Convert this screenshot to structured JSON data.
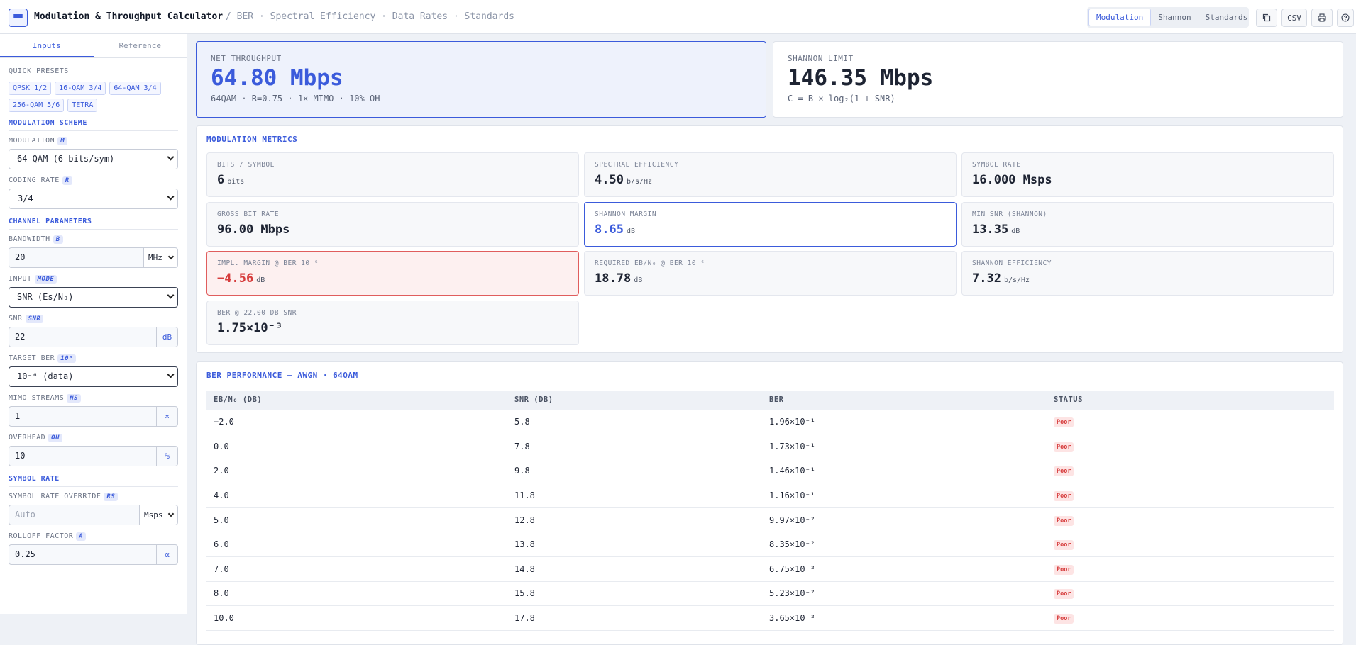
{
  "header": {
    "title": "Modulation & Throughput Calculator",
    "breadcrumb": "/ BER · Spectral Efficiency · Data Rates · Standards",
    "tabs": [
      "Modulation",
      "Shannon",
      "Standards"
    ],
    "active_tab": "Modulation",
    "tools": {
      "copy_icon": "copy-icon",
      "csv_label": "CSV",
      "print_icon": "print-icon",
      "help_icon": "help-icon"
    }
  },
  "sidebar": {
    "tabs": [
      "Inputs",
      "Reference"
    ],
    "quick_presets_label": "QUICK PRESETS",
    "presets": [
      "QPSK 1/2",
      "16-QAM 3/4",
      "64-QAM 3/4",
      "256-QAM 5/6",
      "TETRA"
    ],
    "modulation_scheme_label": "MODULATION SCHEME",
    "modulation": {
      "label": "MODULATION",
      "tag": "M",
      "value": "64-QAM (6 bits/sym)"
    },
    "coding_rate": {
      "label": "CODING RATE",
      "tag": "R",
      "value": "3/4"
    },
    "channel_params_label": "CHANNEL PARAMETERS",
    "bandwidth": {
      "label": "BANDWIDTH",
      "tag": "B",
      "value": "20",
      "unit": "MHz"
    },
    "input_mode": {
      "label": "INPUT",
      "tag": "MODE",
      "value": "SNR (Es/N₀)"
    },
    "snr": {
      "label": "SNR",
      "tag": "SNR",
      "value": "22",
      "unit": "dB"
    },
    "target_ber": {
      "label": "TARGET BER",
      "tag": "10ˣ",
      "value": "10⁻⁶ (data)"
    },
    "mimo": {
      "label": "MIMO STREAMS",
      "tag": "NS",
      "value": "1",
      "unit": "×"
    },
    "overhead": {
      "label": "OVERHEAD",
      "tag": "OH",
      "value": "10",
      "unit": "%"
    },
    "symbol_rate_label": "SYMBOL RATE",
    "symbol_rate_override": {
      "label": "SYMBOL RATE OVERRIDE",
      "tag": "RS",
      "placeholder": "Auto",
      "unit": "Msps"
    },
    "rolloff": {
      "label": "ROLLOFF FACTOR",
      "tag": "A",
      "value": "0.25",
      "unit": "α"
    }
  },
  "hero": {
    "net": {
      "label": "NET THROUGHPUT",
      "value": "64.80 Mbps",
      "sub": "64QAM · R=0.75 · 1× MIMO · 10% OH"
    },
    "shannon": {
      "label": "SHANNON LIMIT",
      "value": "146.35 Mbps",
      "sub": "C = B × log₂(1 + SNR)"
    }
  },
  "metrics": {
    "title": "MODULATION METRICS",
    "cards": [
      {
        "label": "BITS / SYMBOL",
        "value": "6",
        "unit": "bits",
        "style": "normal"
      },
      {
        "label": "SPECTRAL EFFICIENCY",
        "value": "4.50",
        "unit": "b/s/Hz",
        "style": "normal"
      },
      {
        "label": "SYMBOL RATE",
        "value": "16.000 Msps",
        "unit": "",
        "style": "normal"
      },
      {
        "label": "GROSS BIT RATE",
        "value": "96.00 Mbps",
        "unit": "",
        "style": "normal"
      },
      {
        "label": "SHANNON MARGIN",
        "value": "8.65",
        "unit": "dB",
        "style": "blue"
      },
      {
        "label": "MIN SNR (SHANNON)",
        "value": "13.35",
        "unit": "dB",
        "style": "normal"
      },
      {
        "label": "IMPL. MARGIN @ BER 10⁻⁶",
        "value": "−4.56",
        "unit": "dB",
        "style": "red"
      },
      {
        "label": "REQUIRED EB/N₀ @ BER 10⁻⁶",
        "value": "18.78",
        "unit": "dB",
        "style": "normal"
      },
      {
        "label": "SHANNON EFFICIENCY",
        "value": "7.32",
        "unit": "b/s/Hz",
        "style": "normal"
      },
      {
        "label": "BER @ 22.00 DB SNR",
        "value": "1.75×10⁻³",
        "unit": "",
        "style": "normal"
      }
    ]
  },
  "ber_table": {
    "title": "BER PERFORMANCE — AWGN · 64QAM",
    "columns": [
      "EB/N₀ (DB)",
      "SNR (DB)",
      "BER",
      "STATUS"
    ],
    "rows": [
      [
        "−2.0",
        "5.8",
        "1.96×10⁻¹",
        "Poor"
      ],
      [
        "0.0",
        "7.8",
        "1.73×10⁻¹",
        "Poor"
      ],
      [
        "2.0",
        "9.8",
        "1.46×10⁻¹",
        "Poor"
      ],
      [
        "4.0",
        "11.8",
        "1.16×10⁻¹",
        "Poor"
      ],
      [
        "5.0",
        "12.8",
        "9.97×10⁻²",
        "Poor"
      ],
      [
        "6.0",
        "13.8",
        "8.35×10⁻²",
        "Poor"
      ],
      [
        "7.0",
        "14.8",
        "6.75×10⁻²",
        "Poor"
      ],
      [
        "8.0",
        "15.8",
        "5.23×10⁻²",
        "Poor"
      ],
      [
        "10.0",
        "17.8",
        "3.65×10⁻²",
        "Poor"
      ]
    ]
  },
  "colors": {
    "accent": "#3b5bdb",
    "danger": "#d63c3c",
    "background": "#eef1f6"
  }
}
